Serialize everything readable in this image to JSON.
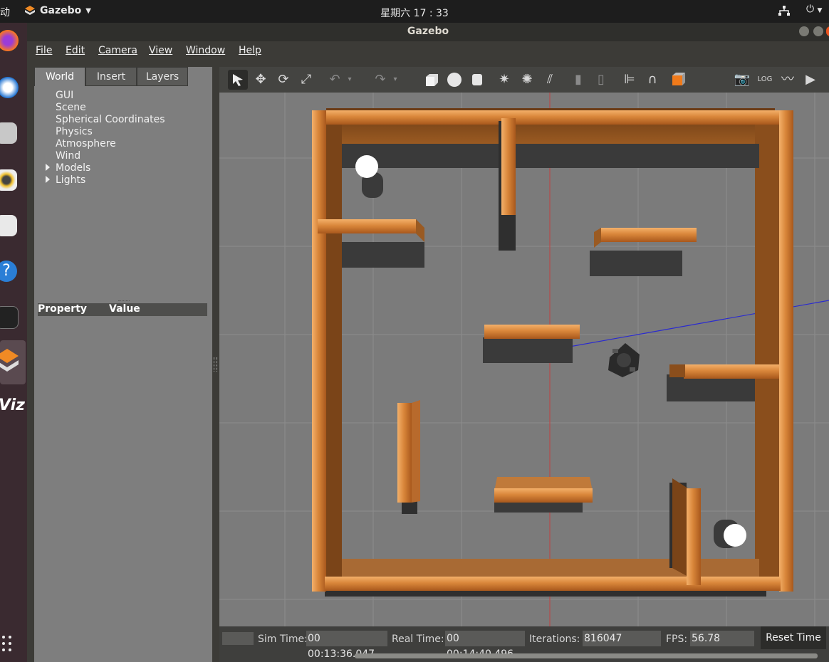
{
  "topbar": {
    "activities": "动",
    "app_name": "Gazebo",
    "clock": "星期六 17 : 33"
  },
  "window": {
    "title": "Gazebo"
  },
  "menu": [
    "File",
    "Edit",
    "Camera",
    "View",
    "Window",
    "Help"
  ],
  "left_panel": {
    "tabs": [
      "World",
      "Insert",
      "Layers"
    ],
    "active_tab": "World",
    "tree_items": [
      "GUI",
      "Scene",
      "Spherical Coordinates",
      "Physics",
      "Atmosphere",
      "Wind",
      "Models",
      "Lights"
    ],
    "property_header": "Property",
    "value_header": "Value"
  },
  "toolbar_icons": [
    "select-arrow-icon",
    "translate-icon",
    "rotate-icon",
    "scale-icon",
    "undo-icon",
    "redo-icon",
    "box-icon",
    "sphere-icon",
    "cylinder-icon",
    "point-light-icon",
    "spot-light-icon",
    "directional-light-icon",
    "copy-icon",
    "paste-icon",
    "align-icon",
    "snap-icon",
    "view-angle-icon",
    "screenshot-icon",
    "log-icon",
    "plot-icon",
    "video-icon"
  ],
  "status": {
    "sim_time_label": "Sim Time:",
    "sim_time": "00 00:13:36.047",
    "real_time_label": "Real Time:",
    "real_time": "00 00:14:40.496",
    "iterations_label": "Iterations:",
    "iterations": "816047",
    "fps_label": "FPS:",
    "fps": "56.78",
    "reset_button": "Reset Time"
  },
  "colors": {
    "wood": "#d98a3c",
    "ground": "#7b7b7b",
    "grid": "#8e8e8e",
    "panel": "#7e7e7e"
  }
}
